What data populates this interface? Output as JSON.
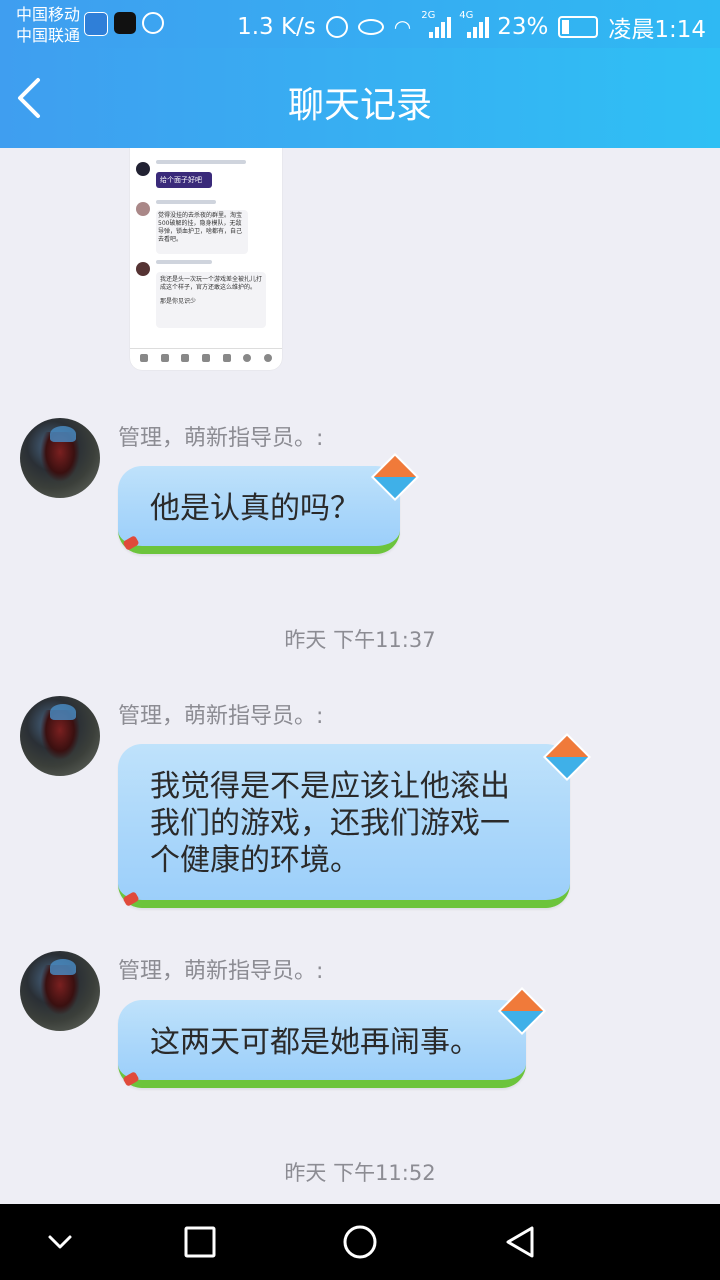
{
  "status": {
    "carrier1": "中国移动",
    "carrier2": "中国联通",
    "speed": "1.3 K/s",
    "net2g": "2G",
    "net4g": "4G",
    "battery": "23%",
    "time": "凌晨1:14"
  },
  "header": {
    "title": "聊天记录"
  },
  "messages": [
    {
      "sender": "管理，萌新指导员。:",
      "text": "他是认真的吗？"
    },
    {
      "sender": "管理，萌新指导员。:",
      "text": "我觉得是不是应该让他滚出我们的游戏，还我们游戏一个健康的环境。"
    },
    {
      "sender": "管理，萌新指导员。:",
      "text": "这两天可都是她再闹事。"
    }
  ],
  "timestamps": [
    "昨天 下午11:37",
    "昨天 下午11:52"
  ],
  "thumbnail": {
    "line1": "给个面子好吧",
    "line2": "觉得没挂的去杀夜的群里。淘宝500破解的挂，隐身模队，无敌导弹，锁血护卫，啥都有，自己去看吧。",
    "line3": "我还是头一次玩一个游戏差全被扎儿打成这个样子，官方还敢这么维护的。",
    "line4": "那是你见识少"
  }
}
